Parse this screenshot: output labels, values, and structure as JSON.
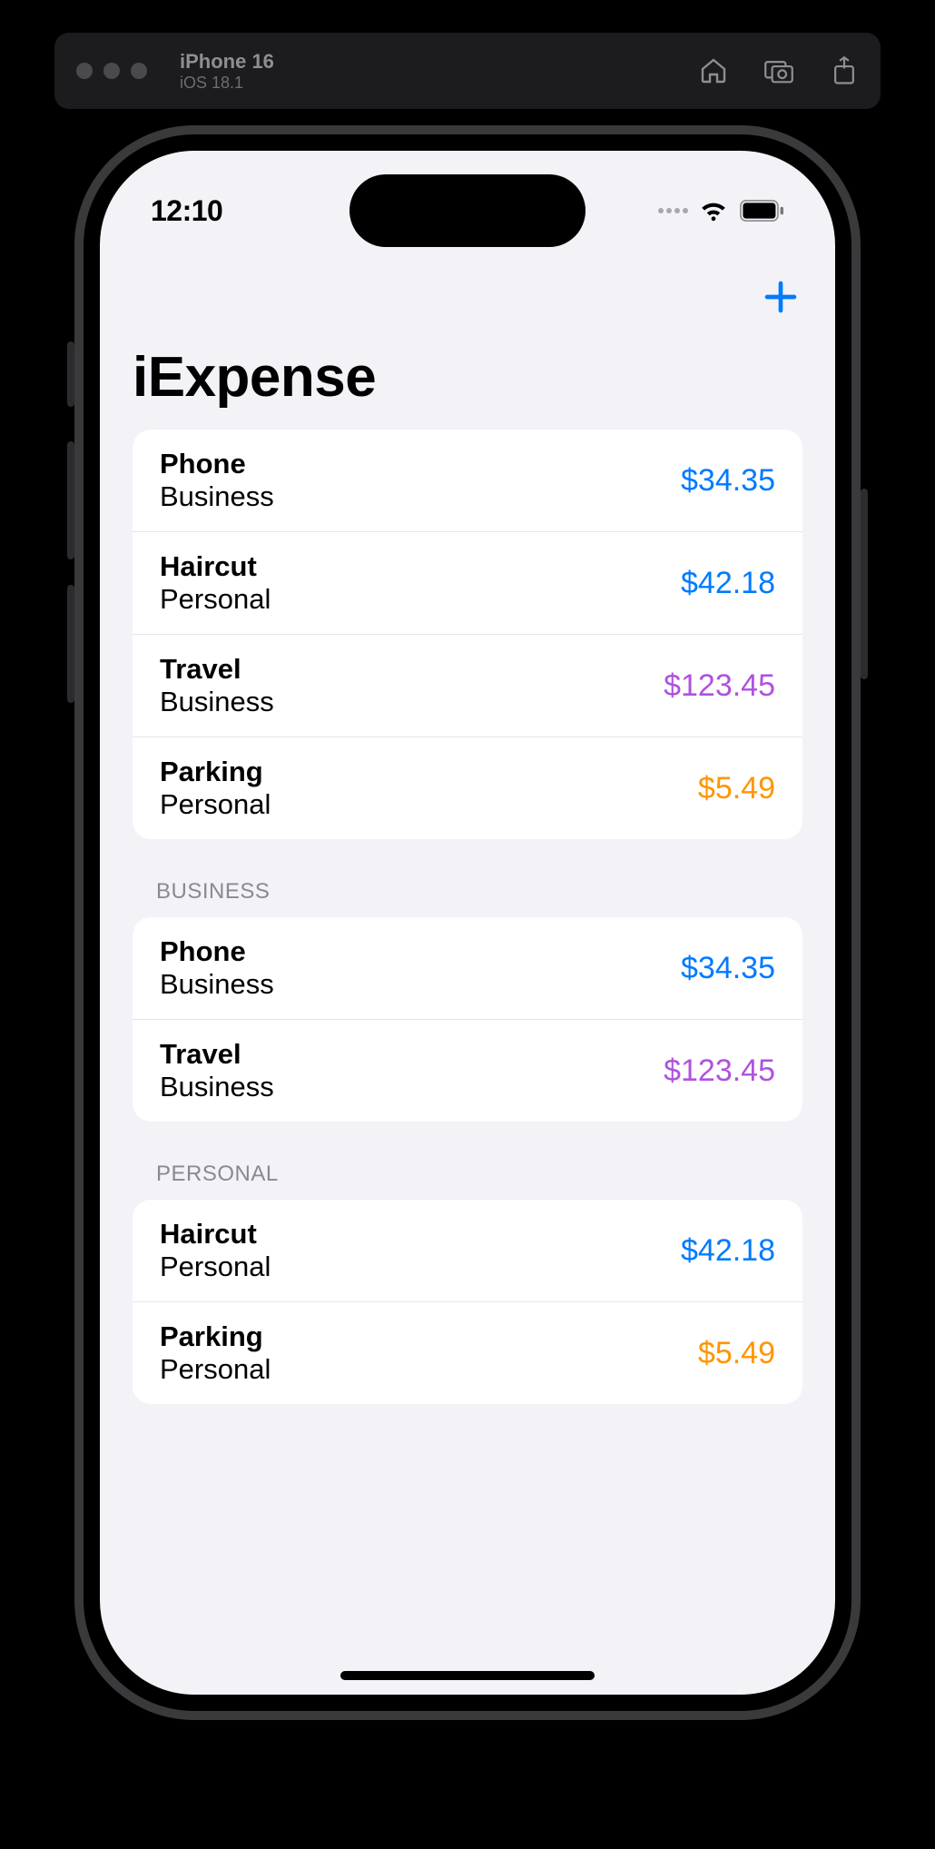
{
  "simulator": {
    "device_name": "iPhone 16",
    "os_version": "iOS 18.1"
  },
  "status": {
    "time": "12:10"
  },
  "app": {
    "title": "iExpense"
  },
  "colors": {
    "blue": "#007aff",
    "purple": "#af52de",
    "orange": "#ff9500"
  },
  "sections": [
    {
      "header": null,
      "items": [
        {
          "name": "Phone",
          "type": "Business",
          "amount": "$34.35",
          "color": "blue"
        },
        {
          "name": "Haircut",
          "type": "Personal",
          "amount": "$42.18",
          "color": "blue"
        },
        {
          "name": "Travel",
          "type": "Business",
          "amount": "$123.45",
          "color": "purple"
        },
        {
          "name": "Parking",
          "type": "Personal",
          "amount": "$5.49",
          "color": "orange"
        }
      ]
    },
    {
      "header": "BUSINESS",
      "items": [
        {
          "name": "Phone",
          "type": "Business",
          "amount": "$34.35",
          "color": "blue"
        },
        {
          "name": "Travel",
          "type": "Business",
          "amount": "$123.45",
          "color": "purple"
        }
      ]
    },
    {
      "header": "PERSONAL",
      "items": [
        {
          "name": "Haircut",
          "type": "Personal",
          "amount": "$42.18",
          "color": "blue"
        },
        {
          "name": "Parking",
          "type": "Personal",
          "amount": "$5.49",
          "color": "orange"
        }
      ]
    }
  ]
}
